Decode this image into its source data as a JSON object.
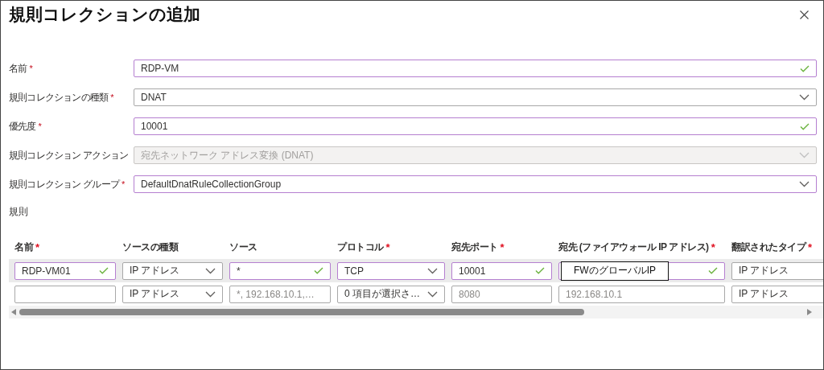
{
  "dialog": {
    "title": "規則コレクションの追加"
  },
  "form": {
    "fields": [
      {
        "label": "名前",
        "required_mark": "*",
        "kind": "text",
        "value": "RDP-VM",
        "edited": true,
        "valid": true,
        "disabled": false
      },
      {
        "label": "規則コレクションの種類",
        "required_mark": "*",
        "kind": "dropdown",
        "value": "DNAT",
        "edited": false,
        "valid": false,
        "disabled": false
      },
      {
        "label": "優先度",
        "required_mark": "*",
        "kind": "text",
        "value": "10001",
        "edited": true,
        "valid": true,
        "disabled": false
      },
      {
        "label": "規則コレクション アクション",
        "kind": "dropdown",
        "value": "宛先ネットワーク アドレス変換 (DNAT)",
        "edited": false,
        "valid": false,
        "disabled": true
      },
      {
        "label": "規則コレクション グループ",
        "required_mark": "*",
        "kind": "dropdown",
        "value": "DefaultDnatRuleCollectionGroup",
        "edited": true,
        "valid": false,
        "disabled": false
      }
    ]
  },
  "rules": {
    "label": "規則",
    "columns": [
      {
        "label": "名前",
        "required_mark": "*"
      },
      {
        "label": "ソースの種類"
      },
      {
        "label": "ソース"
      },
      {
        "label": "プロトコル",
        "required_mark": "*"
      },
      {
        "label": "宛先ポート",
        "required_mark": "*"
      },
      {
        "label": "宛先 (ファイアウォール IP アドレス)",
        "required_mark": "*"
      },
      {
        "label": "翻訳されたタイプ",
        "required_mark": "*"
      }
    ],
    "rows": [
      {
        "highlighted": true,
        "cells": [
          {
            "kind": "text",
            "value": "RDP-VM01",
            "edited": true,
            "valid": true
          },
          {
            "kind": "dropdown",
            "value": "IP アドレス",
            "edited": false,
            "valid": false
          },
          {
            "kind": "text",
            "value": "*",
            "edited": true,
            "valid": true
          },
          {
            "kind": "dropdown",
            "value": "TCP",
            "edited": true,
            "valid": false
          },
          {
            "kind": "text",
            "value": "10001",
            "edited": true,
            "valid": true
          },
          {
            "kind": "text",
            "edited": true,
            "valid": true,
            "note": "FWのグローバルIP"
          },
          {
            "kind": "text",
            "value": "IP アドレス",
            "edited": false,
            "valid": false
          }
        ]
      },
      {
        "highlighted": false,
        "cells": [
          {
            "kind": "text",
            "edited": false,
            "valid": false
          },
          {
            "kind": "dropdown",
            "value": "IP アドレス",
            "edited": false,
            "valid": false
          },
          {
            "kind": "text",
            "placeholder": "*, 192.168.10.1,…",
            "edited": false,
            "valid": false
          },
          {
            "kind": "dropdown",
            "value": "0 項目が選択さ…",
            "edited": false,
            "valid": false
          },
          {
            "kind": "text",
            "placeholder": "8080",
            "edited": false,
            "valid": false
          },
          {
            "kind": "text",
            "placeholder": "192.168.10.1",
            "edited": false,
            "valid": false
          },
          {
            "kind": "text",
            "value": "IP アドレス",
            "edited": false,
            "valid": false
          }
        ]
      }
    ]
  }
}
